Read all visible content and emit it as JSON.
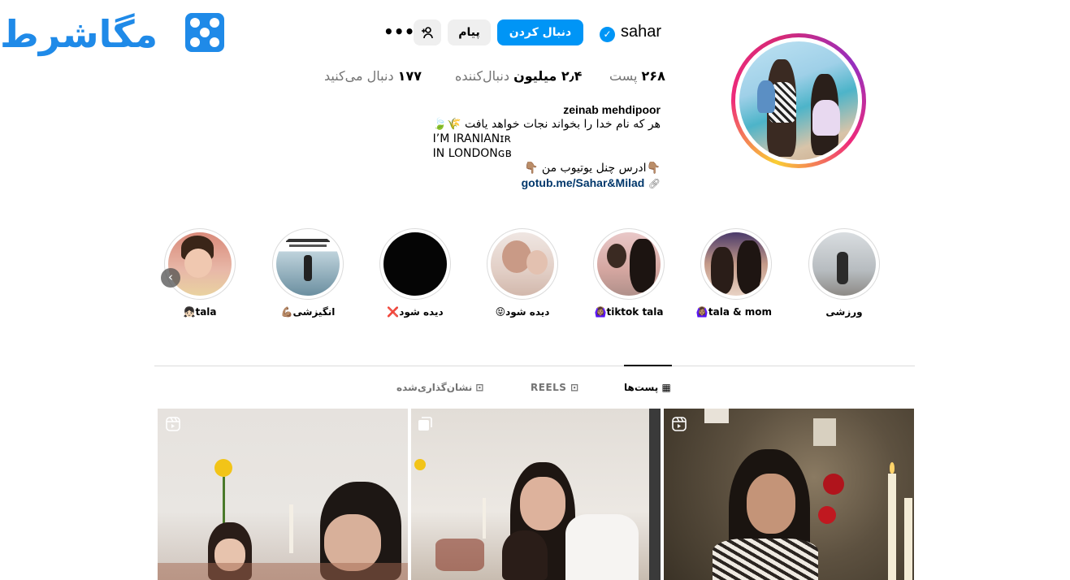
{
  "watermark": {
    "text": "مگاشرط"
  },
  "profile": {
    "username": "sahar",
    "verified_icon": "verified-badge-icon",
    "follow_label": "دنبال کردن",
    "message_label": "پیام",
    "add_person_icon": "add-person-icon",
    "more_icon": "more-options-icon",
    "stats": {
      "posts_value": "۲۶۸",
      "posts_label": "پست",
      "followers_value": "۲٫۴ میلیون",
      "followers_label": "دنبال‌کننده",
      "following_value": "۱۷۷",
      "following_label": "دنبال می‌کنید"
    },
    "bio": {
      "full_name": "zeinab mehdipoor",
      "line1": "هر که نام خدا را بخواند نجات خواهد یافت 🌾🍃",
      "line2": "I’M IRANIANɪʀ",
      "line3": "IN LONDONɢʙ",
      "line4": "👇🏽ادرس چنل یوتیوب من 👇🏽",
      "link": "gotub.me/Sahar&Milad",
      "link_icon": "link-icon"
    }
  },
  "highlights": [
    {
      "label": "ورزشی"
    },
    {
      "label": "tala & mom🙆🏽‍♀️"
    },
    {
      "label": "tiktok tala🙆🏽‍♀️"
    },
    {
      "label": "دیده شود😝"
    },
    {
      "label": "دیده شود❌"
    },
    {
      "label": "انگیزشی💪🏽"
    },
    {
      "label": "tala👧🏻"
    }
  ],
  "highlight_prev_icon": "chevron-left-icon",
  "tabs": [
    {
      "label": "پست‌ها",
      "icon": "grid-icon",
      "active": true
    },
    {
      "label": "REELS",
      "icon": "reels-icon",
      "active": false
    },
    {
      "label": "نشان‌گذاری‌شده",
      "icon": "tagged-icon",
      "active": false
    }
  ],
  "posts": [
    {
      "type": "reel",
      "icon": "reels-icon"
    },
    {
      "type": "carousel",
      "icon": "carousel-icon"
    },
    {
      "type": "reel",
      "icon": "reels-icon"
    }
  ]
}
